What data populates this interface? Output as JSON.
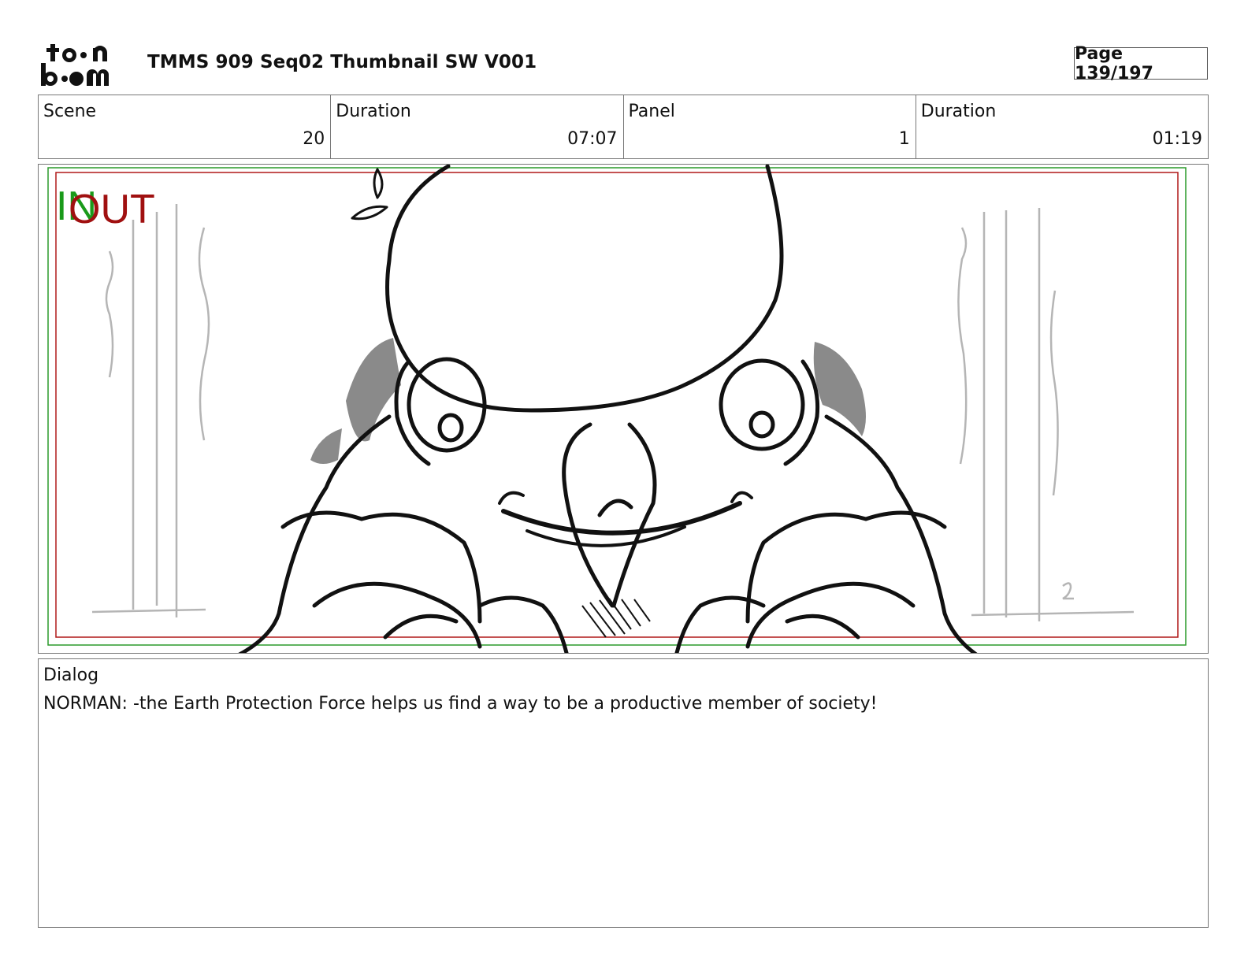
{
  "header": {
    "logo_text": "toon boom",
    "title": "TMMS 909 Seq02 Thumbnail SW V001",
    "page_label": "Page 139/197"
  },
  "info": {
    "scene_label": "Scene",
    "scene_value": "20",
    "scene_duration_label": "Duration",
    "scene_duration_value": "07:07",
    "panel_label": "Panel",
    "panel_value": "1",
    "panel_duration_label": "Duration",
    "panel_duration_value": "01:19"
  },
  "panel": {
    "in_marker": "IN",
    "out_marker": "OUT",
    "in_color": "#1a9a1a",
    "out_color": "#a01010"
  },
  "dialog": {
    "label": "Dialog",
    "text": "NORMAN: -the Earth Protection Force helps us find a way to be a productive member of society!"
  }
}
